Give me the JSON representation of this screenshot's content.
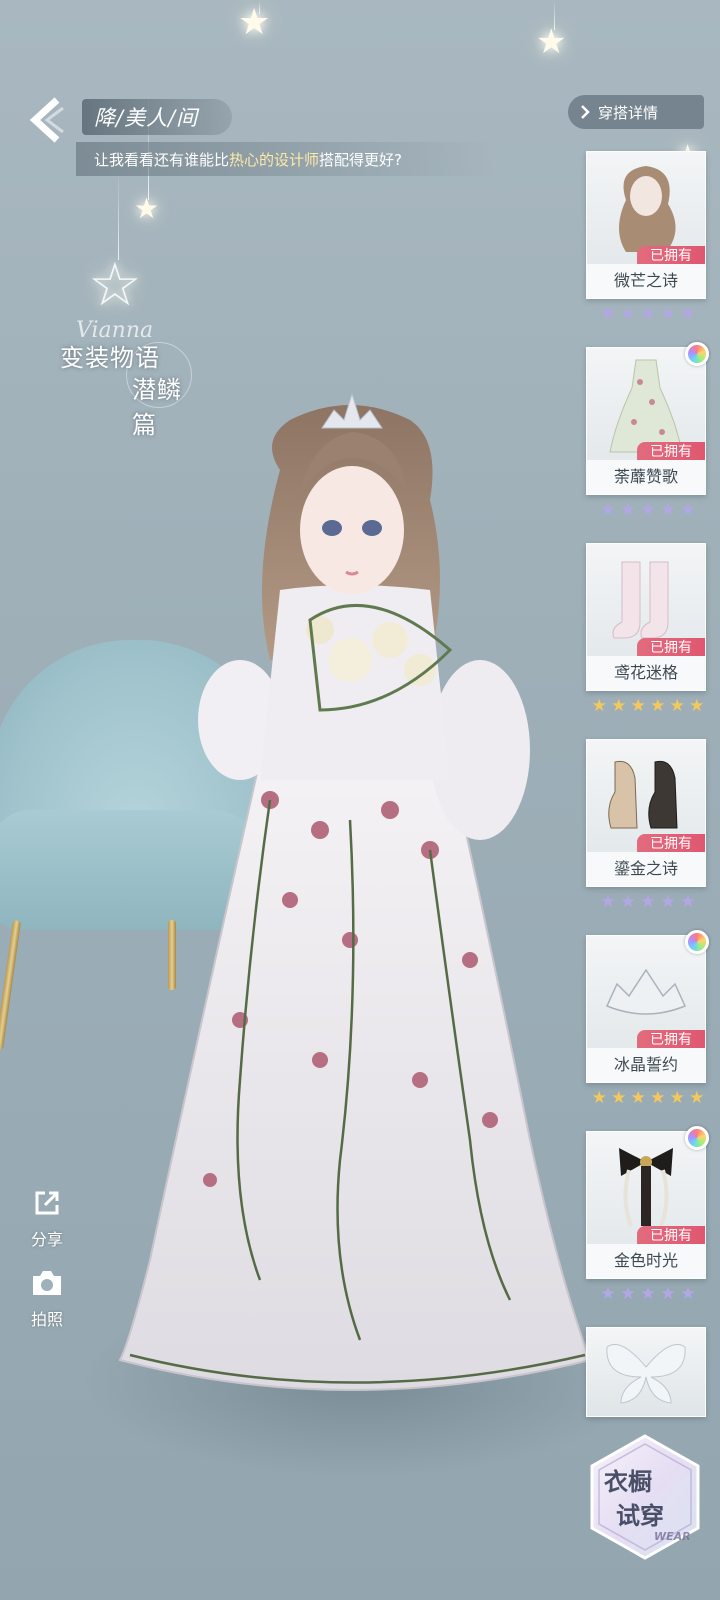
{
  "header": {
    "title": "降/美人/间",
    "subtitle_prefix": "让我看看还有谁能比",
    "subtitle_highlight": "热心的设计师",
    "subtitle_suffix": "搭配得更好?"
  },
  "logo": {
    "script": "Vianna",
    "line1": "变装物语",
    "line2": "潜鳞篇"
  },
  "details_button": {
    "label": "穿搭详情"
  },
  "side_actions": [
    {
      "label": "分享",
      "icon": "share-icon"
    },
    {
      "label": "拍照",
      "icon": "camera-icon"
    }
  ],
  "owned_label": "已拥有",
  "items": [
    {
      "name": "微芒之诗",
      "icon": "hair-icon",
      "star_color": "purple",
      "stars": 5,
      "owned": true,
      "rainbow": false
    },
    {
      "name": "荼蘼赞歌",
      "icon": "dress-icon",
      "star_color": "purple",
      "stars": 5,
      "owned": true,
      "rainbow": true
    },
    {
      "name": "鸢花迷格",
      "icon": "socks-icon",
      "star_color": "gold",
      "stars": 6,
      "owned": true,
      "rainbow": false
    },
    {
      "name": "鎏金之诗",
      "icon": "shoes-icon",
      "star_color": "purple",
      "stars": 5,
      "owned": true,
      "rainbow": false
    },
    {
      "name": "冰晶誓约",
      "icon": "tiara-icon",
      "star_color": "gold",
      "stars": 6,
      "owned": true,
      "rainbow": true
    },
    {
      "name": "金色时光",
      "icon": "hair-bow-icon",
      "star_color": "purple",
      "stars": 5,
      "owned": true,
      "rainbow": true
    },
    {
      "name": "",
      "icon": "butterfly-wings-icon",
      "partial": true
    }
  ],
  "tryon": {
    "line1": "衣橱",
    "line2": "试穿",
    "tag": "WEAR"
  },
  "colors": {
    "owned_tag": "#e05770",
    "gold_star": "#f5c85a",
    "purple_star": "#b3a6e6"
  }
}
